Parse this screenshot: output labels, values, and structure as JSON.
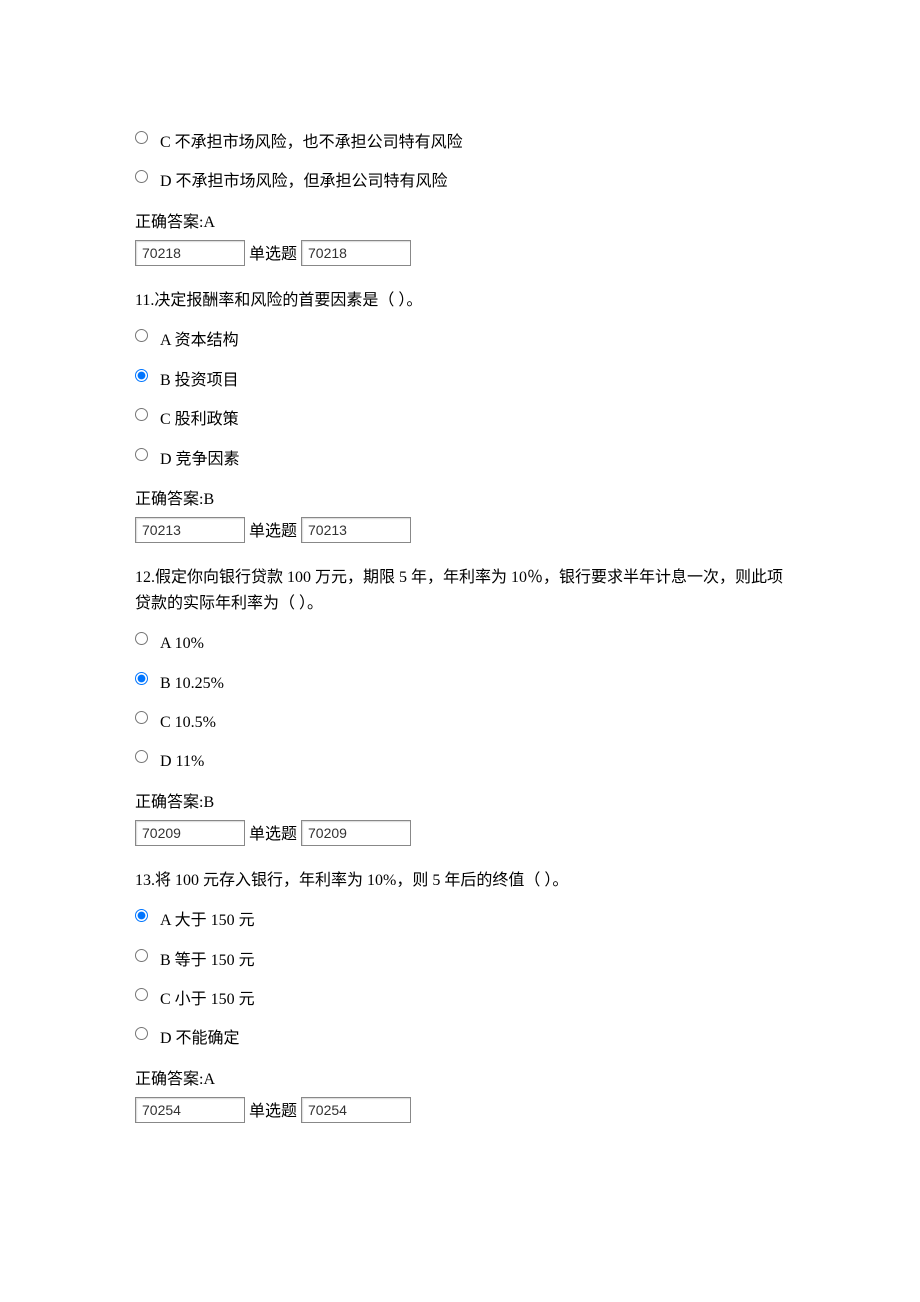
{
  "q10": {
    "options": {
      "c": "C 不承担市场风险，也不承担公司特有风险",
      "d": "D 不承担市场风险，但承担公司特有风险"
    },
    "answer": "正确答案:A",
    "meta": {
      "id1": "70218",
      "qtype": "单选题",
      "id2": "70218"
    }
  },
  "q11": {
    "text": "11.决定报酬率和风险的首要因素是（ ）。",
    "options": {
      "a": "A 资本结构",
      "b": "B 投资项目",
      "c": "C 股利政策",
      "d": "D 竞争因素"
    },
    "answer": "正确答案:B",
    "meta": {
      "id1": "70213",
      "qtype": "单选题",
      "id2": "70213"
    }
  },
  "q12": {
    "text": "12.假定你向银行贷款 100 万元，期限 5 年，年利率为 10％，银行要求半年计息一次，则此项贷款的实际年利率为（ ）。",
    "options": {
      "a": "A 10%",
      "b": "B 10.25%",
      "c": "C 10.5%",
      "d": "D 11%"
    },
    "answer": "正确答案:B",
    "meta": {
      "id1": "70209",
      "qtype": "单选题",
      "id2": "70209"
    }
  },
  "q13": {
    "text": "13.将 100 元存入银行，年利率为 10%，则 5 年后的终值（ ）。",
    "options": {
      "a": "A 大于 150 元",
      "b": "B 等于 150 元",
      "c": "C 小于 150 元",
      "d": "D 不能确定"
    },
    "answer": "正确答案:A",
    "meta": {
      "id1": "70254",
      "qtype": "单选题",
      "id2": "70254"
    }
  }
}
